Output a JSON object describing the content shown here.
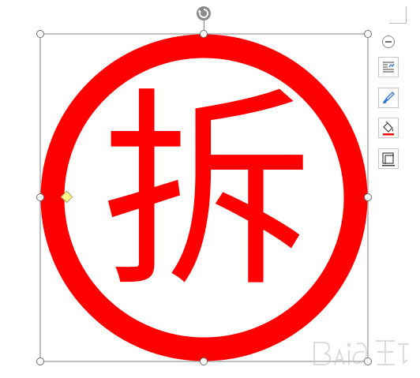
{
  "document": {
    "shape": {
      "glyph": "拆",
      "ring_color": "#ff0000",
      "fill_color": "#ffffff"
    },
    "selection": {
      "frame_color": "#808080",
      "adjust_handle_color": "#ffff88"
    }
  },
  "layout_options_toolbar": {
    "collapse_icon": "minus-circle-icon",
    "buttons": [
      {
        "icon": "layout-options-icon"
      },
      {
        "icon": "brush-style-icon"
      },
      {
        "icon": "fill-bucket-icon",
        "accent": "#ff0000"
      },
      {
        "icon": "shape-outline-icon"
      }
    ]
  }
}
